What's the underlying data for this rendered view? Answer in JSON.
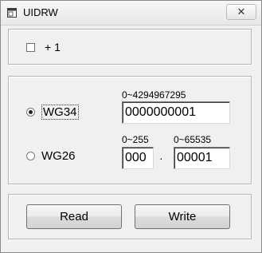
{
  "window": {
    "title": "UIDRW",
    "close_label": "✕"
  },
  "options": {
    "plus_one_label": "+ 1",
    "plus_one_checked": false
  },
  "wg34": {
    "label": "WG34",
    "selected": true,
    "range_label": "0~4294967295",
    "value": "0000000001"
  },
  "wg26": {
    "label": "WG26",
    "selected": false,
    "facility_range_label": "0~255",
    "facility_value": "000",
    "separator": "·",
    "card_range_label": "0~65535",
    "card_value": "00001"
  },
  "actions": {
    "read_label": "Read",
    "write_label": "Write"
  }
}
